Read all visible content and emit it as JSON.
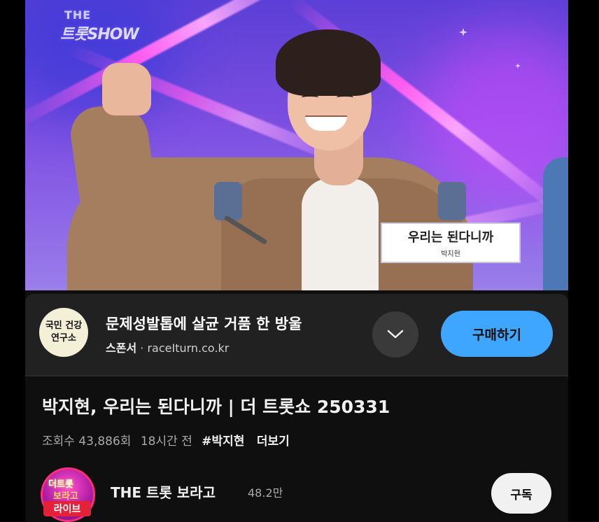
{
  "video": {
    "show_logo_top": "THE",
    "show_logo_main": "트롯SHOW",
    "caption_title": "우리는 된다니까",
    "caption_singer": "박지현"
  },
  "ad": {
    "logo_line1": "국민 건강",
    "logo_line2": "연구소",
    "title": "문제성발톱에 살균 거품 한 방울",
    "sponsor_label": "스폰서",
    "separator": "·",
    "domain": "raceIturn.co.kr",
    "expand_icon": "chevron-down-icon",
    "cta_label": "구매하기",
    "cta_color": "#3ea6ff"
  },
  "video_info": {
    "title": "박지현, 우리는 된다니까 | 더 트롯쇼 250331",
    "views": "조회수 43,886회",
    "age": "18시간 전",
    "hashtag": "#박지현",
    "more_label": "더보기"
  },
  "channel": {
    "avatar_text_top": "더트롯",
    "avatar_text_mid": "보라고",
    "live_badge": "라이브",
    "name": "THE 트롯 보라고",
    "subscribers": "48.2만",
    "subscribe_label": "구독"
  }
}
